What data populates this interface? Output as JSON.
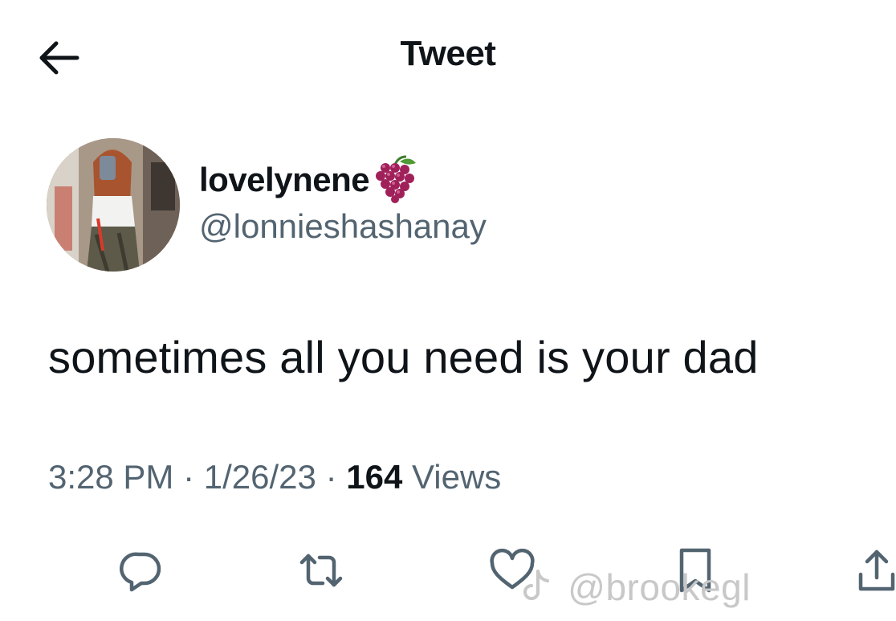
{
  "header": {
    "title": "Tweet",
    "back_icon": "arrow-left-icon"
  },
  "author": {
    "display_name": "lovelynene",
    "emoji_icon": "grapes-icon",
    "handle": "@lonnieshashanay"
  },
  "tweet": {
    "text": "sometimes all you need is your dad",
    "time": "3:28 PM",
    "date": "1/26/23",
    "separator": "·",
    "views_count": "164",
    "views_label": "Views"
  },
  "actions": [
    {
      "name": "reply",
      "icon": "reply-icon"
    },
    {
      "name": "retweet",
      "icon": "retweet-icon"
    },
    {
      "name": "like",
      "icon": "heart-icon"
    },
    {
      "name": "bookmark",
      "icon": "bookmark-icon"
    },
    {
      "name": "share",
      "icon": "share-icon"
    }
  ],
  "watermark": {
    "text": "@brookegl"
  },
  "colors": {
    "text_primary": "#0f1419",
    "text_secondary": "#536471",
    "icon": "#536471",
    "watermark": "#c8c8c8",
    "grape": "#a0205a"
  }
}
